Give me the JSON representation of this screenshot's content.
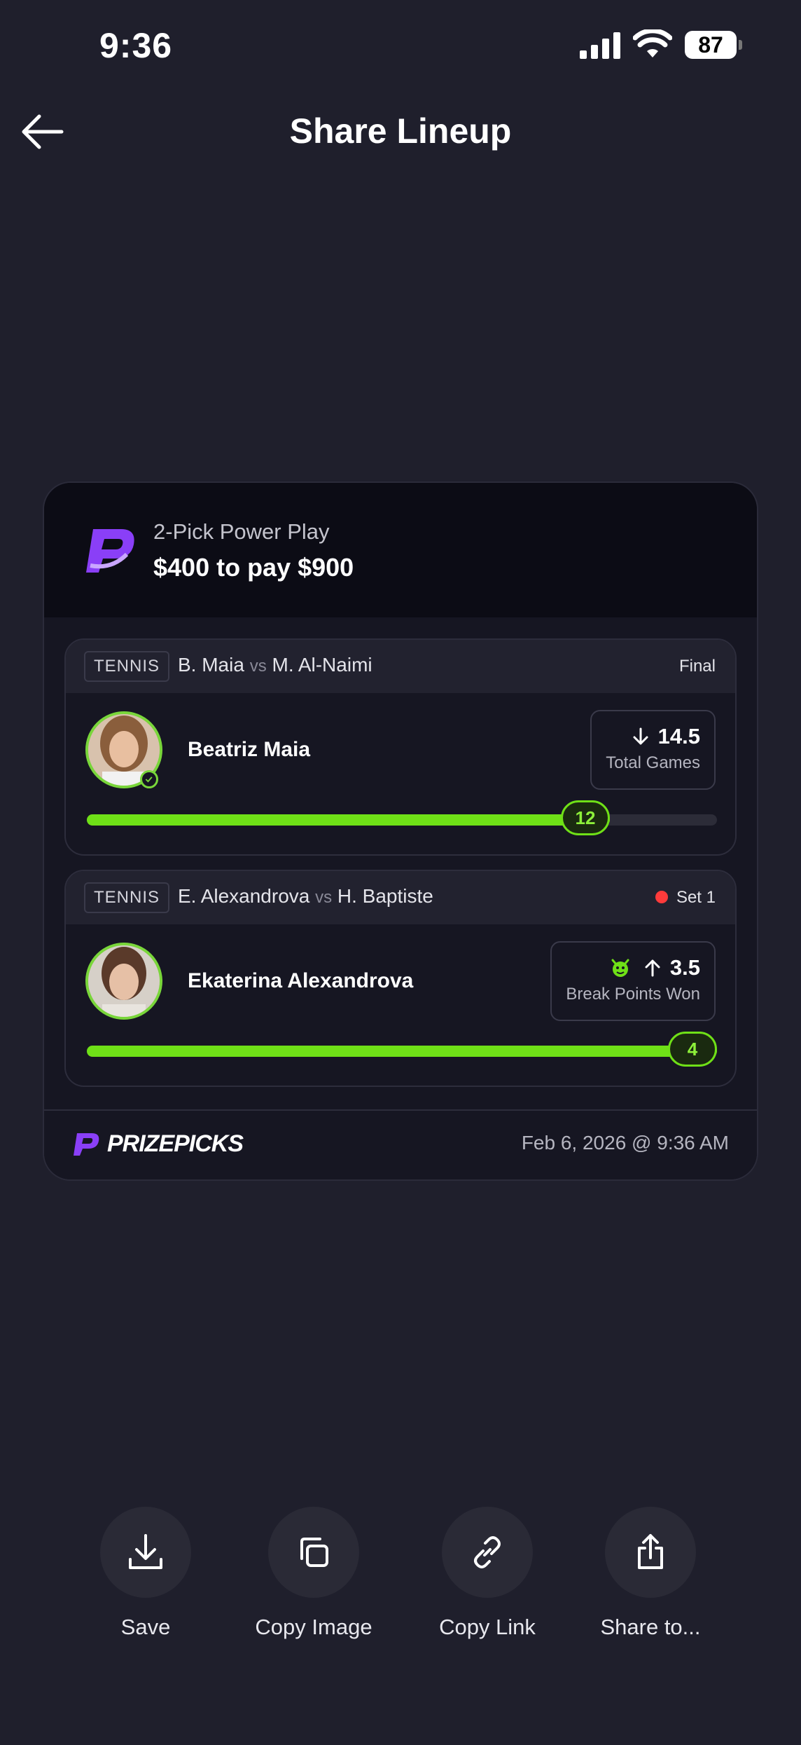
{
  "status_bar": {
    "time": "9:36",
    "battery": "87"
  },
  "nav": {
    "title": "Share Lineup"
  },
  "card": {
    "play_type": "2-Pick Power Play",
    "amount": "$400 to pay $900",
    "picks": [
      {
        "sport": "TENNIS",
        "player_a": "B. Maia",
        "vs": "vs",
        "player_b": "M. Al-Naimi",
        "status": "Final",
        "player_name": "Beatriz Maia",
        "direction": "down",
        "line": "14.5",
        "stat": "Total Games",
        "current": "12",
        "progress": 0.83
      },
      {
        "sport": "TENNIS",
        "player_a": "E. Alexandrova",
        "vs": "vs",
        "player_b": "H. Baptiste",
        "status": "Set 1",
        "player_name": "Ekaterina Alexandrova",
        "direction": "up",
        "line": "3.5",
        "stat": "Break Points Won",
        "current": "4",
        "progress": 1.0
      }
    ],
    "brand": "PRIZEPICKS",
    "timestamp": "Feb 6, 2026 @ 9:36 AM"
  },
  "actions": [
    {
      "label": "Save",
      "icon": "download-icon"
    },
    {
      "label": "Copy Image",
      "icon": "copy-icon"
    },
    {
      "label": "Copy Link",
      "icon": "link-icon"
    },
    {
      "label": "Share to...",
      "icon": "share-icon"
    }
  ],
  "colors": {
    "accent_green": "#6fe017",
    "brand_purple": "#7b2ff7",
    "live_red": "#ff3b3b"
  }
}
